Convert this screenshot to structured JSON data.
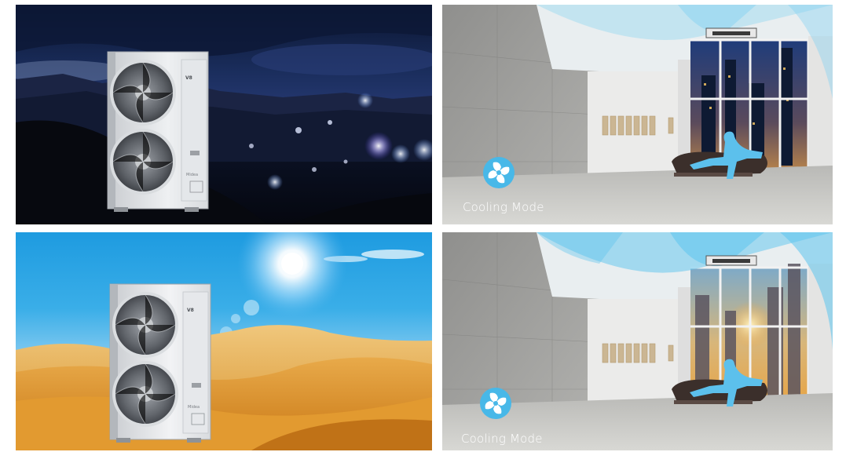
{
  "panels": {
    "top_right": {
      "mode_label": "Cooling Mode"
    },
    "bottom_right": {
      "mode_label": "Cooling Mode"
    }
  },
  "outdoor_unit": {
    "badge": "V8",
    "brand": "Midea"
  },
  "colors": {
    "mode_icon": "#48b8e8",
    "airflow": "#7fd0f2",
    "person_silhouette": "#5cc0ec"
  },
  "icons": [
    "fan-mode-icon"
  ]
}
